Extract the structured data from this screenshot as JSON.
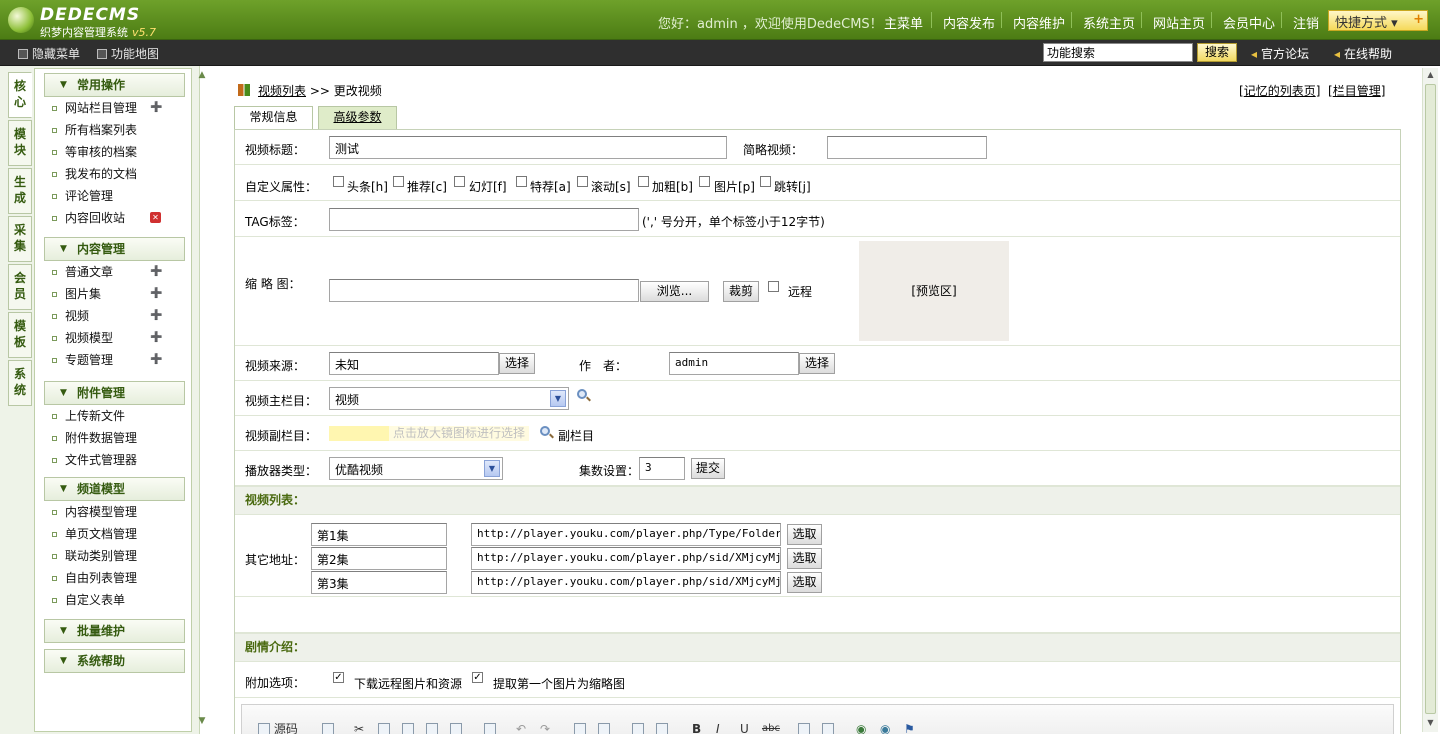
{
  "header": {
    "logo_title": "DEDECMS",
    "logo_subtitle": "织梦内容管理系统",
    "logo_version": "v5.7",
    "greeting": "您好：admin ，欢迎使用DedeCMS！",
    "nav": [
      "主菜单",
      "内容发布",
      "内容维护",
      "系统主页",
      "网站主页",
      "会员中心",
      "注销"
    ],
    "quick_menu": "快捷方式"
  },
  "toolbar": {
    "hide_menu": "隐藏菜单",
    "function_map": "功能地图",
    "search_value": "功能搜索",
    "search_button": "搜索",
    "forum_link": "官方论坛",
    "help_link": "在线帮助"
  },
  "vtabs": [
    "核心",
    "模块",
    "生成",
    "采集",
    "会员",
    "模板",
    "系统"
  ],
  "menu": {
    "sections": [
      {
        "title": "常用操作",
        "items": [
          "网站栏目管理",
          "所有档案列表",
          "等审核的档案",
          "我发布的文档",
          "评论管理",
          "内容回收站"
        ]
      },
      {
        "title": "内容管理",
        "items": [
          "普通文章",
          "图片集",
          "视频",
          "视频模型",
          "专题管理"
        ]
      },
      {
        "title": "附件管理",
        "items": [
          "上传新文件",
          "附件数据管理",
          "文件式管理器"
        ]
      },
      {
        "title": "频道模型",
        "items": [
          "内容模型管理",
          "单页文档管理",
          "联动类别管理",
          "自由列表管理",
          "自定义表单"
        ]
      },
      {
        "title": "批量维护",
        "items": []
      },
      {
        "title": "系统帮助",
        "items": []
      }
    ]
  },
  "page": {
    "crumb_link": "视频列表",
    "crumb_sep": ">>",
    "crumb_current": "更改视频",
    "link_remember": "记忆的列表页",
    "link_column": "栏目管理",
    "tab_normal": "常规信息",
    "tab_advanced": "高级参数"
  },
  "form": {
    "title_label": "视频标题：",
    "title_value": "测试",
    "short_label": "简略视频：",
    "short_value": "",
    "flags_label": "自定义属性：",
    "flags": [
      "头条[h]",
      "推荐[c]",
      "幻灯[f]",
      "特荐[a]",
      "滚动[s]",
      "加粗[b]",
      "图片[p]",
      "跳转[j]"
    ],
    "tag_label": "TAG标签：",
    "tag_value": "",
    "tag_hint": "(',' 号分开，单个标签小于12字节)",
    "thumb_label": "缩 略 图：",
    "thumb_value": "",
    "browse_button": "浏览...",
    "crop_button": "裁剪",
    "remote_label": "远程",
    "preview_text": "[预览区]",
    "source_label": "视频来源：",
    "source_value": "未知",
    "source_button": "选择",
    "author_label": "作　者：",
    "author_value": "admin",
    "author_button": "选择",
    "main_col_label": "视频主栏目：",
    "main_col_value": "视频",
    "sub_col_label": "视频副栏目：",
    "sub_col_hint": "点击放大镜图标进行选择",
    "sub_col_link": "副栏目",
    "player_label": "播放器类型：",
    "player_value": "优酷视频",
    "episodes_label": "集数设置：",
    "episodes_value": "3",
    "submit_button": "提交",
    "video_list_title": "视频列表：",
    "other_url_label": "其它地址：",
    "videos": [
      {
        "name": "第1集",
        "url": "http://player.youku.com/player.php/Type/Folder/Fid/",
        "button": "选取"
      },
      {
        "name": "第2集",
        "url": "http://player.youku.com/player.php/sid/XMjcyMjk1OTA",
        "button": "选取"
      },
      {
        "name": "第3集",
        "url": "http://player.youku.com/player.php/sid/XMjcyMjk1OTA",
        "button": "选取"
      }
    ],
    "plot_title": "剧情介绍：",
    "extra_label": "附加选项：",
    "extra_options": [
      "下载远程图片和资源",
      "提取第一个图片为缩略图"
    ]
  },
  "editor": {
    "source_button": "源码"
  }
}
